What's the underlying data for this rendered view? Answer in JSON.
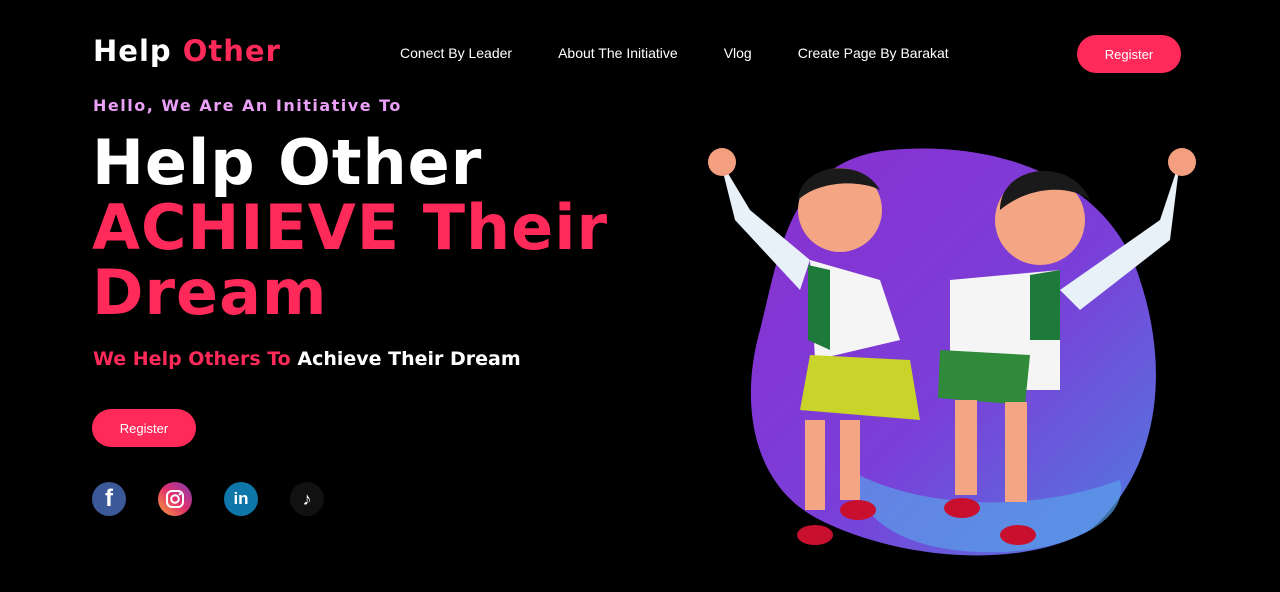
{
  "logo": {
    "part1": "Help",
    "part2": "Other"
  },
  "nav": [
    {
      "label": "Conect By Leader"
    },
    {
      "label": "About The Initiative"
    },
    {
      "label": "Vlog"
    },
    {
      "label": "Create Page By Barakat"
    }
  ],
  "header": {
    "register_label": "Register"
  },
  "hero": {
    "intro": "Hello, We Are An Initiative To",
    "line1": "Help Other",
    "line2": "ACHIEVE Their",
    "line3": "Dream",
    "sub_red": "We Help Others To",
    "sub_white": "Achieve Their Dream",
    "register_label": "Register"
  },
  "socials": [
    {
      "icon": "facebook-icon",
      "glyph": "f"
    },
    {
      "icon": "instagram-icon",
      "glyph": ""
    },
    {
      "icon": "linkedin-icon",
      "glyph": "in"
    },
    {
      "icon": "tiktok-icon",
      "glyph": "♪"
    }
  ],
  "colors": {
    "accent": "#ff2a5a",
    "intro": "#e9a0f6",
    "background": "#000000"
  }
}
